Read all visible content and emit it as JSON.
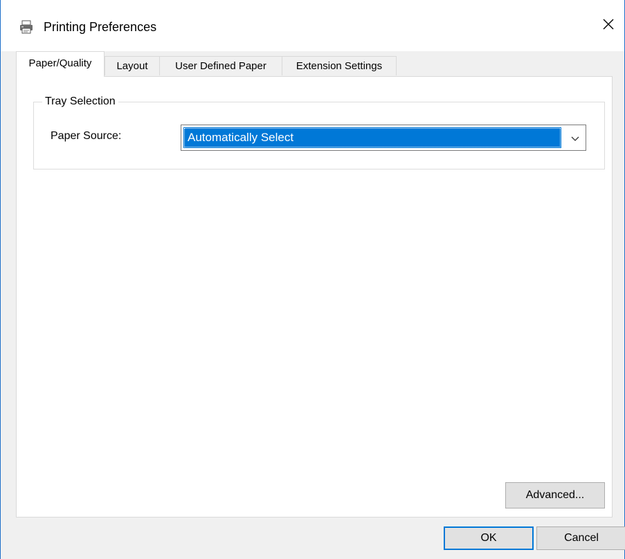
{
  "window": {
    "title": "Printing Preferences",
    "icon": "printer-icon",
    "close_icon": "close-icon"
  },
  "tabs": [
    {
      "label": "Paper/Quality",
      "active": true
    },
    {
      "label": "Layout",
      "active": false
    },
    {
      "label": "User Defined Paper",
      "active": false
    },
    {
      "label": "Extension Settings",
      "active": false
    }
  ],
  "tray_selection": {
    "legend": "Tray Selection",
    "paper_source_label": "Paper Source:",
    "paper_source_value": "Automatically Select",
    "dropdown_icon": "chevron-down-icon"
  },
  "buttons": {
    "advanced": "Advanced...",
    "ok": "OK",
    "cancel": "Cancel"
  },
  "colors": {
    "selection": "#0078d7",
    "window_border": "#1e6fc9",
    "background": "#f0f0f0"
  }
}
